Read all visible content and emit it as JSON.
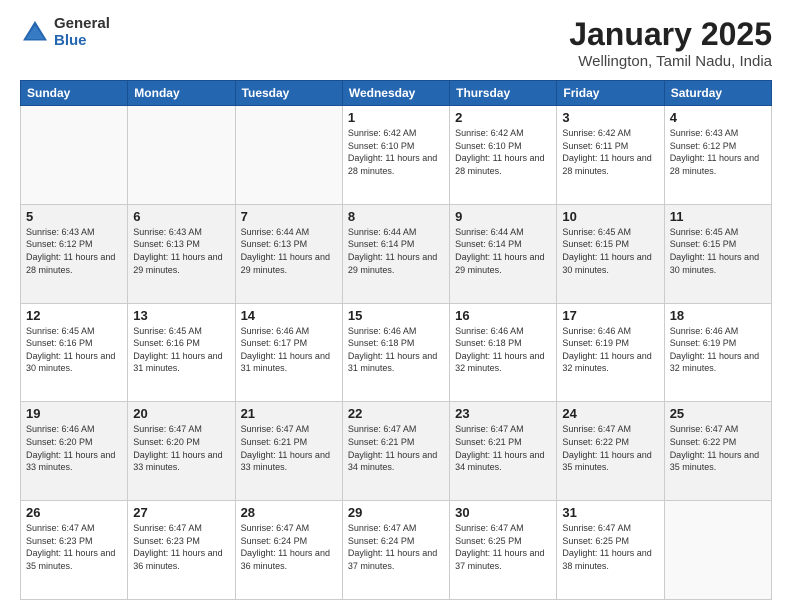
{
  "logo": {
    "general": "General",
    "blue": "Blue"
  },
  "title": {
    "month": "January 2025",
    "location": "Wellington, Tamil Nadu, India"
  },
  "days_of_week": [
    "Sunday",
    "Monday",
    "Tuesday",
    "Wednesday",
    "Thursday",
    "Friday",
    "Saturday"
  ],
  "weeks": [
    [
      {
        "day": "",
        "info": ""
      },
      {
        "day": "",
        "info": ""
      },
      {
        "day": "",
        "info": ""
      },
      {
        "day": "1",
        "info": "Sunrise: 6:42 AM\nSunset: 6:10 PM\nDaylight: 11 hours and 28 minutes."
      },
      {
        "day": "2",
        "info": "Sunrise: 6:42 AM\nSunset: 6:10 PM\nDaylight: 11 hours and 28 minutes."
      },
      {
        "day": "3",
        "info": "Sunrise: 6:42 AM\nSunset: 6:11 PM\nDaylight: 11 hours and 28 minutes."
      },
      {
        "day": "4",
        "info": "Sunrise: 6:43 AM\nSunset: 6:12 PM\nDaylight: 11 hours and 28 minutes."
      }
    ],
    [
      {
        "day": "5",
        "info": "Sunrise: 6:43 AM\nSunset: 6:12 PM\nDaylight: 11 hours and 28 minutes."
      },
      {
        "day": "6",
        "info": "Sunrise: 6:43 AM\nSunset: 6:13 PM\nDaylight: 11 hours and 29 minutes."
      },
      {
        "day": "7",
        "info": "Sunrise: 6:44 AM\nSunset: 6:13 PM\nDaylight: 11 hours and 29 minutes."
      },
      {
        "day": "8",
        "info": "Sunrise: 6:44 AM\nSunset: 6:14 PM\nDaylight: 11 hours and 29 minutes."
      },
      {
        "day": "9",
        "info": "Sunrise: 6:44 AM\nSunset: 6:14 PM\nDaylight: 11 hours and 29 minutes."
      },
      {
        "day": "10",
        "info": "Sunrise: 6:45 AM\nSunset: 6:15 PM\nDaylight: 11 hours and 30 minutes."
      },
      {
        "day": "11",
        "info": "Sunrise: 6:45 AM\nSunset: 6:15 PM\nDaylight: 11 hours and 30 minutes."
      }
    ],
    [
      {
        "day": "12",
        "info": "Sunrise: 6:45 AM\nSunset: 6:16 PM\nDaylight: 11 hours and 30 minutes."
      },
      {
        "day": "13",
        "info": "Sunrise: 6:45 AM\nSunset: 6:16 PM\nDaylight: 11 hours and 31 minutes."
      },
      {
        "day": "14",
        "info": "Sunrise: 6:46 AM\nSunset: 6:17 PM\nDaylight: 11 hours and 31 minutes."
      },
      {
        "day": "15",
        "info": "Sunrise: 6:46 AM\nSunset: 6:18 PM\nDaylight: 11 hours and 31 minutes."
      },
      {
        "day": "16",
        "info": "Sunrise: 6:46 AM\nSunset: 6:18 PM\nDaylight: 11 hours and 32 minutes."
      },
      {
        "day": "17",
        "info": "Sunrise: 6:46 AM\nSunset: 6:19 PM\nDaylight: 11 hours and 32 minutes."
      },
      {
        "day": "18",
        "info": "Sunrise: 6:46 AM\nSunset: 6:19 PM\nDaylight: 11 hours and 32 minutes."
      }
    ],
    [
      {
        "day": "19",
        "info": "Sunrise: 6:46 AM\nSunset: 6:20 PM\nDaylight: 11 hours and 33 minutes."
      },
      {
        "day": "20",
        "info": "Sunrise: 6:47 AM\nSunset: 6:20 PM\nDaylight: 11 hours and 33 minutes."
      },
      {
        "day": "21",
        "info": "Sunrise: 6:47 AM\nSunset: 6:21 PM\nDaylight: 11 hours and 33 minutes."
      },
      {
        "day": "22",
        "info": "Sunrise: 6:47 AM\nSunset: 6:21 PM\nDaylight: 11 hours and 34 minutes."
      },
      {
        "day": "23",
        "info": "Sunrise: 6:47 AM\nSunset: 6:21 PM\nDaylight: 11 hours and 34 minutes."
      },
      {
        "day": "24",
        "info": "Sunrise: 6:47 AM\nSunset: 6:22 PM\nDaylight: 11 hours and 35 minutes."
      },
      {
        "day": "25",
        "info": "Sunrise: 6:47 AM\nSunset: 6:22 PM\nDaylight: 11 hours and 35 minutes."
      }
    ],
    [
      {
        "day": "26",
        "info": "Sunrise: 6:47 AM\nSunset: 6:23 PM\nDaylight: 11 hours and 35 minutes."
      },
      {
        "day": "27",
        "info": "Sunrise: 6:47 AM\nSunset: 6:23 PM\nDaylight: 11 hours and 36 minutes."
      },
      {
        "day": "28",
        "info": "Sunrise: 6:47 AM\nSunset: 6:24 PM\nDaylight: 11 hours and 36 minutes."
      },
      {
        "day": "29",
        "info": "Sunrise: 6:47 AM\nSunset: 6:24 PM\nDaylight: 11 hours and 37 minutes."
      },
      {
        "day": "30",
        "info": "Sunrise: 6:47 AM\nSunset: 6:25 PM\nDaylight: 11 hours and 37 minutes."
      },
      {
        "day": "31",
        "info": "Sunrise: 6:47 AM\nSunset: 6:25 PM\nDaylight: 11 hours and 38 minutes."
      },
      {
        "day": "",
        "info": ""
      }
    ]
  ]
}
